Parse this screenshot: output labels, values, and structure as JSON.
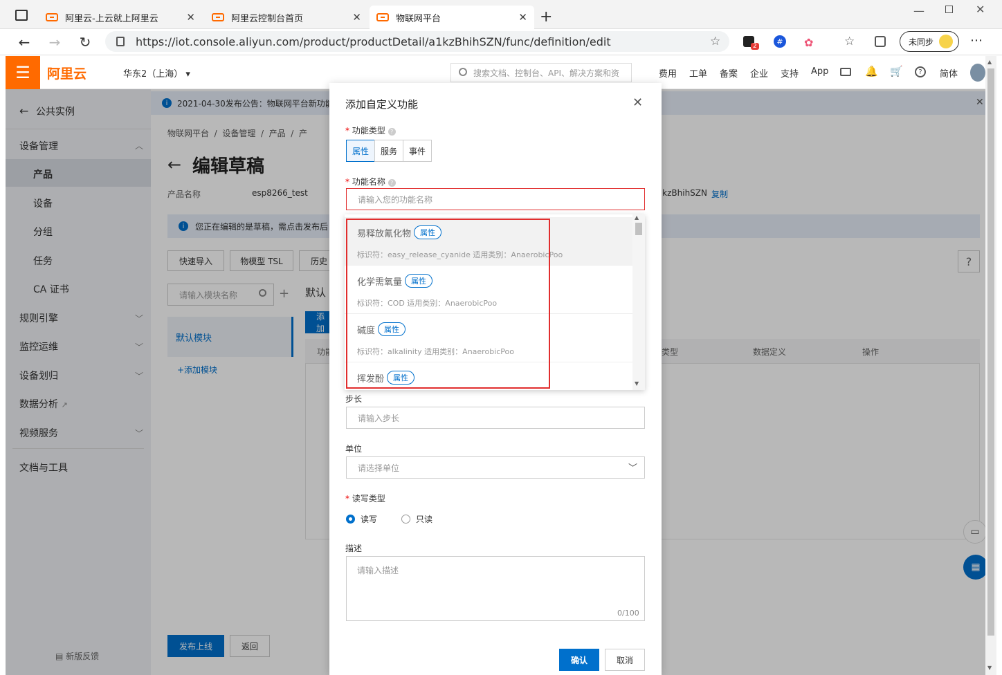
{
  "browser": {
    "tabs": [
      {
        "title": "阿里云-上云就上阿里云"
      },
      {
        "title": "阿里云控制台首页"
      },
      {
        "title": "物联网平台"
      }
    ],
    "url": "https://iot.console.aliyun.com/product/productDetail/a1kzBhihSZN/func/definition/edit",
    "sync_label": "未同步",
    "badge_count": "2"
  },
  "topnav": {
    "logo": "阿里云",
    "region": "华东2（上海）",
    "search_placeholder": "搜索文档、控制台、API、解决方案和资",
    "items": [
      "费用",
      "工单",
      "备案",
      "企业",
      "支持",
      "App"
    ],
    "lang": "简体"
  },
  "sidebar": {
    "back": "公共实例",
    "group_device": "设备管理",
    "subitems": [
      "产品",
      "设备",
      "分组",
      "任务",
      "CA 证书"
    ],
    "groups": [
      "规则引擎",
      "监控运维",
      "设备划归",
      "数据分析",
      "视频服务"
    ],
    "docs": "文档与工具",
    "feedback": "新版反馈"
  },
  "page": {
    "notice": "2021-04-30发布公告：物联网平台新功能",
    "breadcrumb": [
      "物联网平台",
      "设备管理",
      "产品",
      "产"
    ],
    "title": "编辑草稿",
    "product_name_label": "产品名称",
    "product_name_value": "esp8266_test",
    "product_key_tail": "a1kzBhihSZN",
    "copy": "复制",
    "draft_notice": "您正在编辑的是草稿，需点击发布后",
    "buttons": [
      "快速导入",
      "物模型 TSL",
      "历史"
    ],
    "module_search_placeholder": "请输入模块名称",
    "default_module": "默认模块",
    "default_module_header": "默认",
    "add_module": "+添加模块",
    "add_btn": "添加",
    "table_headers": [
      "功能",
      "类型",
      "数据定义",
      "操作"
    ],
    "publish": "发布上线",
    "back": "返回",
    "help": "?"
  },
  "modal": {
    "title": "添加自定义功能",
    "type_label": "功能类型",
    "types": [
      "属性",
      "服务",
      "事件"
    ],
    "name_label": "功能名称",
    "name_placeholder": "请输入您的功能名称",
    "suggestions": [
      {
        "name": "易释放氰化物",
        "tag": "属性",
        "sub": "标识符：easy_release_cyanide 适用类别：AnaerobicPoo"
      },
      {
        "name": "化学需氧量",
        "tag": "属性",
        "sub": "标识符：COD 适用类别：AnaerobicPoo"
      },
      {
        "name": "碱度",
        "tag": "属性",
        "sub": "标识符：alkalinity 适用类别：AnaerobicPoo"
      },
      {
        "name": "挥发酚",
        "tag": "属性",
        "sub": ""
      }
    ],
    "step_label": "步长",
    "step_placeholder": "请输入步长",
    "unit_label": "单位",
    "unit_placeholder": "请选择单位",
    "rw_label": "读写类型",
    "rw_options": [
      "读写",
      "只读"
    ],
    "desc_label": "描述",
    "desc_placeholder": "请输入描述",
    "desc_counter": "0/100",
    "confirm": "确认",
    "cancel": "取消"
  }
}
